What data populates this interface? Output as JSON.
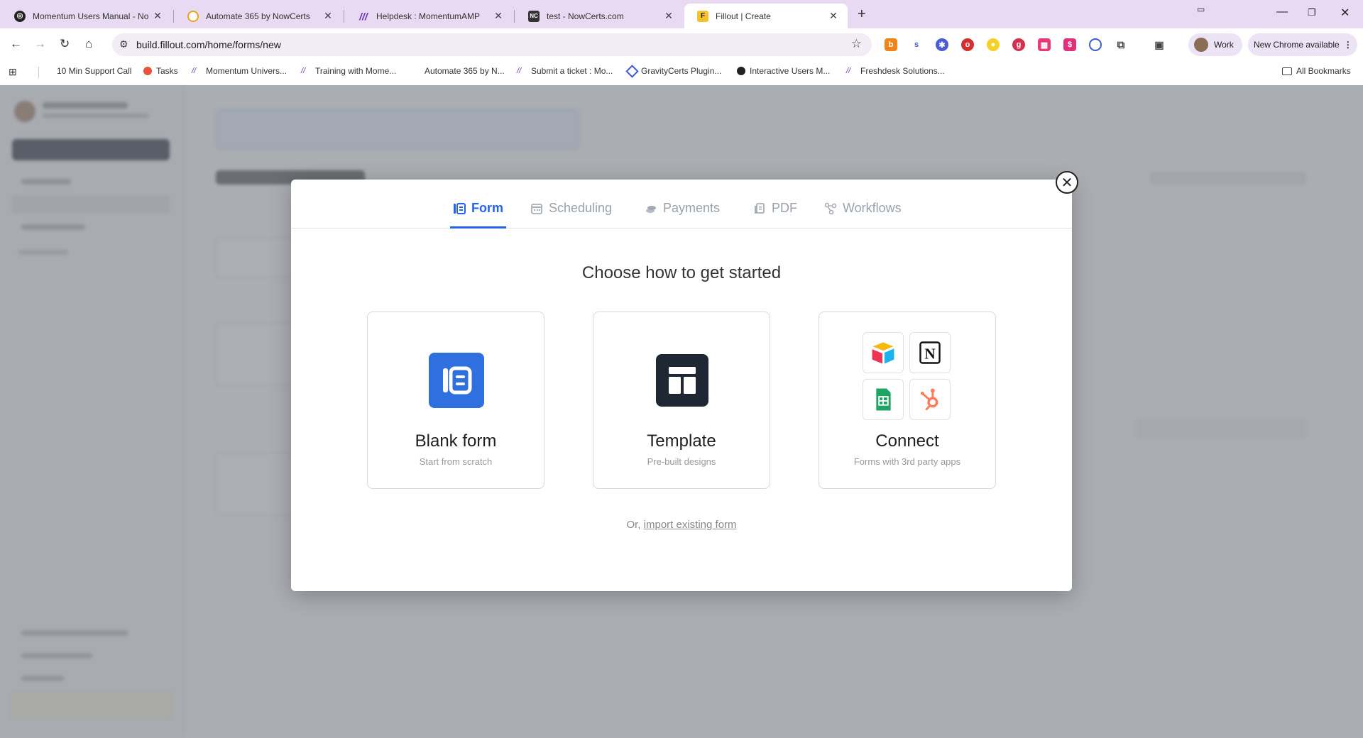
{
  "browser": {
    "tabs": [
      {
        "title": "Momentum Users Manual - No",
        "icon": "momentum-icon",
        "color": "#222222"
      },
      {
        "title": "Automate 365 by NowCerts",
        "icon": "automate-icon",
        "color": "#f0a020"
      },
      {
        "title": "Helpdesk : MomentumAMP",
        "icon": "momentum-m-icon",
        "color": "#6a2fb5"
      },
      {
        "title": "test - NowCerts.com",
        "icon": "nowcerts-icon",
        "color": "#333333"
      },
      {
        "title": "Fillout | Create",
        "icon": "fillout-icon",
        "color": "#f4c22b"
      }
    ],
    "url": "build.fillout.com/home/forms/new",
    "profile_label": "Work",
    "update_label": "New Chrome available",
    "bookmarks": [
      "10 Min Support Call",
      "Tasks",
      "Momentum Univers...",
      "Training with Mome...",
      "Automate 365 by N...",
      "Submit a ticket : Mo...",
      "GravityCerts Plugin...",
      "Interactive Users M...",
      "Freshdesk Solutions..."
    ],
    "all_bookmarks": "All Bookmarks"
  },
  "modal": {
    "tabs": [
      {
        "label": "Form",
        "icon": "form-icon",
        "active": true
      },
      {
        "label": "Scheduling",
        "icon": "calendar-icon",
        "active": false
      },
      {
        "label": "Payments",
        "icon": "payments-icon",
        "active": false
      },
      {
        "label": "PDF",
        "icon": "pdf-icon",
        "active": false
      },
      {
        "label": "Workflows",
        "icon": "workflow-icon",
        "active": false
      }
    ],
    "heading": "Choose how to get started",
    "cards": [
      {
        "title": "Blank form",
        "subtitle": "Start from scratch",
        "icon": "blank-form-icon",
        "color": "#2f6fe0"
      },
      {
        "title": "Template",
        "subtitle": "Pre-built designs",
        "icon": "template-icon",
        "color": "#1f2733"
      },
      {
        "title": "Connect",
        "subtitle": "Forms with 3rd party apps",
        "icon": "integrations-icon"
      }
    ],
    "footer_prefix": "Or,",
    "footer_link": "import existing form"
  },
  "colors": {
    "accent": "#2563eb",
    "tabbar": "#e8daf2"
  }
}
